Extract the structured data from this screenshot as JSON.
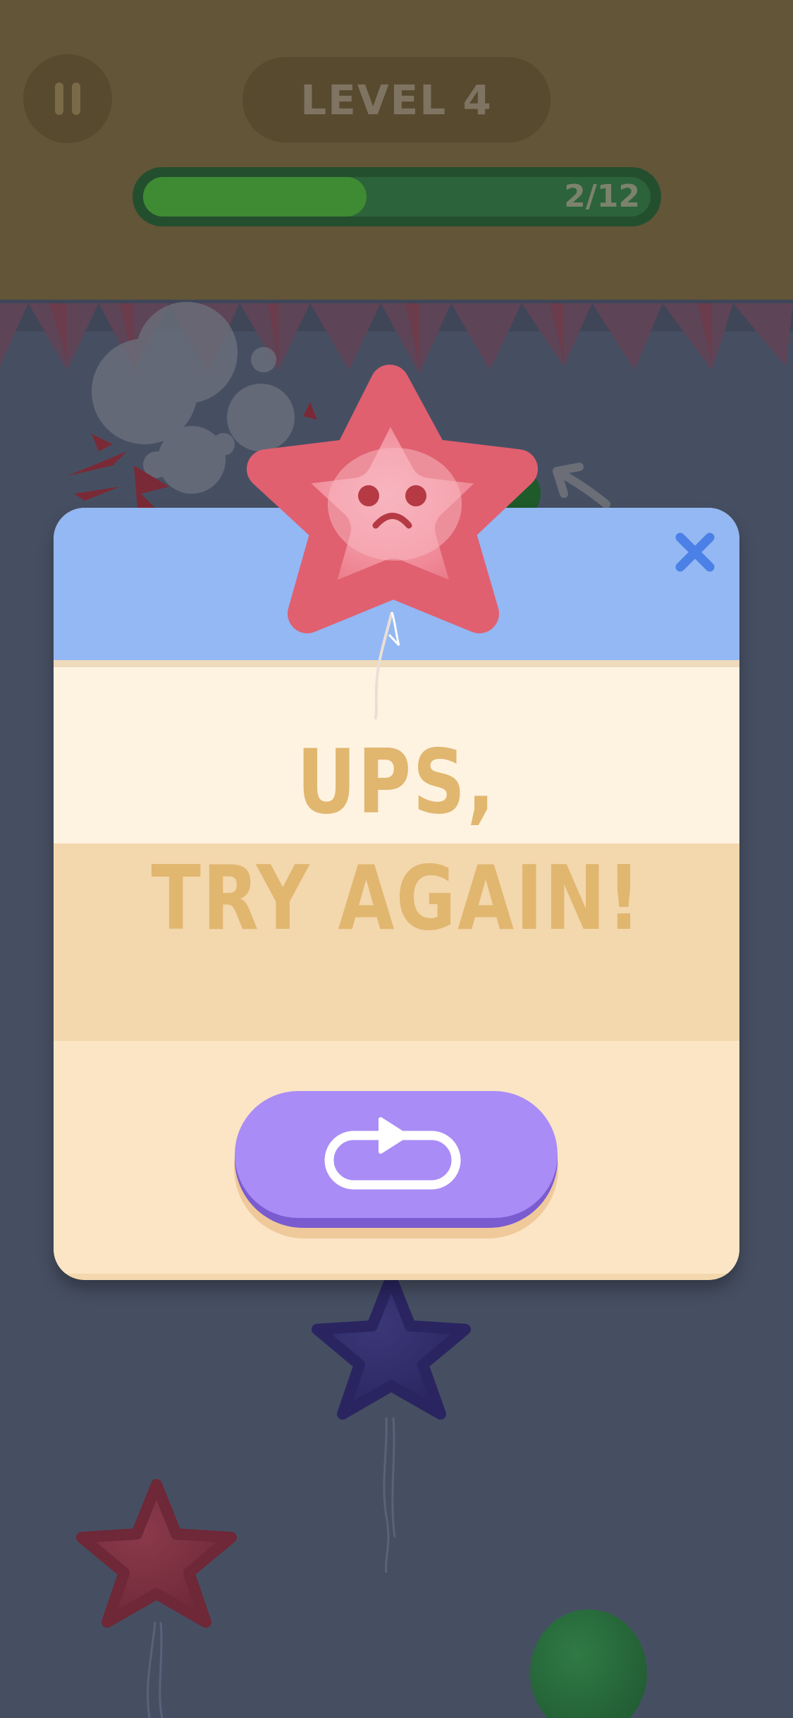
{
  "hud": {
    "pause_icon": "pause-icon",
    "level_label": "LEVEL 4",
    "progress": {
      "current": 2,
      "total": 12,
      "label": "2/12",
      "fill_fraction": 0.44
    }
  },
  "dialog": {
    "message_line1": "UPS,",
    "message_line2": "TRY AGAIN!",
    "close_icon": "close-icon",
    "retry_icon": "retry-icon",
    "popped_balloon": "sad-pink-star-balloon"
  },
  "colors": {
    "background": "#464f62",
    "header_dim": "#625538",
    "progress_fill": "#3f8b33",
    "dialog_header": "#93b8f3",
    "dialog_body": "#fef3e1",
    "message_text": "#e1b66f",
    "retry_button": "#a98cf6",
    "close_icon": "#4b80e6",
    "balloon_pink": "#f07a8a"
  }
}
